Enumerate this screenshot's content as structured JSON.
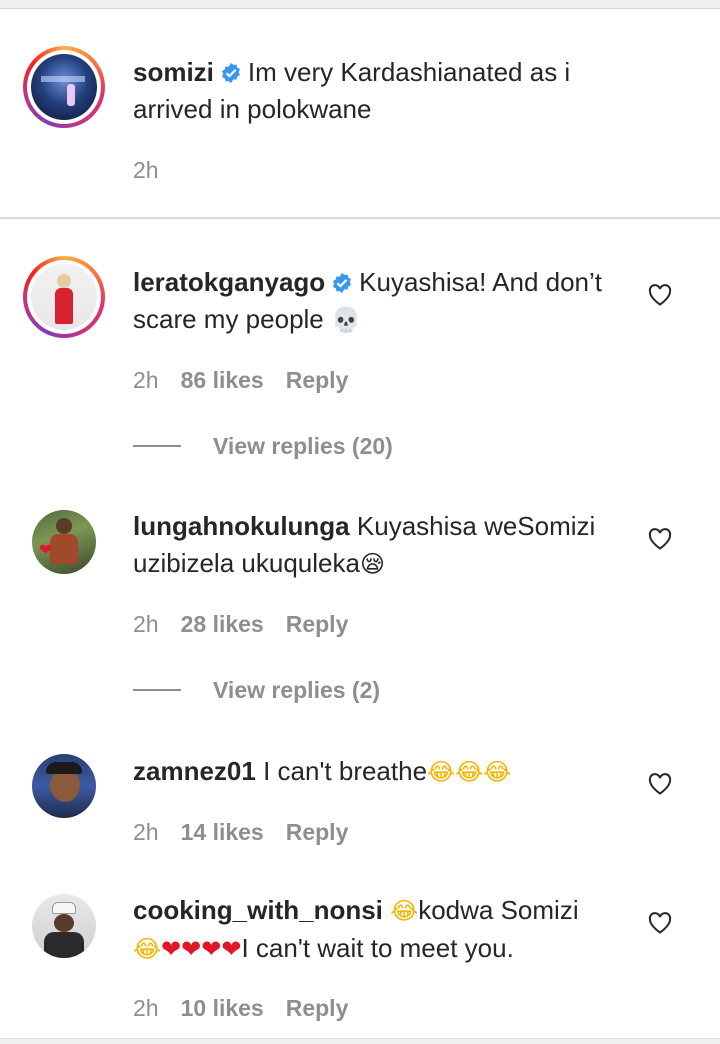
{
  "caption": {
    "username": "somizi",
    "text": "Im very Kardashianated as i arrived in polokwane",
    "time": "2h"
  },
  "comments": [
    {
      "username": "leratokganyago",
      "verified": true,
      "text": "Kuyashisa! And don’t scare my people",
      "emoji": "💀",
      "time": "2h",
      "likes": "86 likes",
      "reply_label": "Reply",
      "view_replies": "View replies (20)"
    },
    {
      "username": "lungahnokulunga",
      "verified": false,
      "text": "Kuyashisa weSomizi uzibizela ukuquleka",
      "emoji": "😪",
      "time": "2h",
      "likes": "28 likes",
      "reply_label": "Reply",
      "view_replies": "View replies (2)"
    },
    {
      "username": "zamnez01",
      "verified": false,
      "text": "I can't breathe",
      "emoji": "😂😂😂",
      "time": "2h",
      "likes": "14 likes",
      "reply_label": "Reply"
    },
    {
      "username": "cooking_with_nonsi",
      "verified": false,
      "emoji_prefix": "😂",
      "text": "kodwa Somizi",
      "emoji_line2": "😂",
      "hearts": "❤❤❤❤",
      "text_line2": "I can't wait to meet you.",
      "time": "2h",
      "likes": "10 likes",
      "reply_label": "Reply"
    }
  ],
  "colors": {
    "verified_blue": "#3897f0",
    "meta_gray": "#8e8e8e",
    "divider": "#dbdbdb"
  }
}
